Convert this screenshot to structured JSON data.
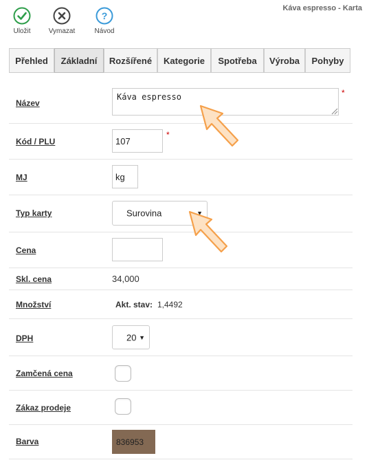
{
  "window": {
    "title": "Káva espresso - Karta"
  },
  "toolbar": {
    "save_label": "Uložit",
    "delete_label": "Vymazat",
    "help_label": "Návod",
    "save_color": "#2e9e4a",
    "delete_color": "#444444",
    "help_color": "#3a9ad9"
  },
  "tabs": [
    {
      "label": "Přehled"
    },
    {
      "label": "Základní",
      "active": true
    },
    {
      "label": "Rozšířené"
    },
    {
      "label": "Kategorie"
    },
    {
      "label": "Spotřeba"
    },
    {
      "label": "Výroba"
    },
    {
      "label": "Pohyby"
    }
  ],
  "form": {
    "nazev": {
      "label": "Název",
      "value": "Káva espresso",
      "required": "*"
    },
    "kod": {
      "label": "Kód / PLU",
      "value": "107",
      "required": "*"
    },
    "mj": {
      "label": "MJ",
      "value": "kg"
    },
    "typ": {
      "label": "Typ karty",
      "value": "Surovina"
    },
    "cena": {
      "label": "Cena",
      "value": ""
    },
    "skl_cena": {
      "label": "Skl. cena",
      "value": "34,000"
    },
    "mnozstvi": {
      "label": "Množství",
      "prefix": "Akt. stav:",
      "value": "1,4492"
    },
    "dph": {
      "label": "DPH",
      "value": "20"
    },
    "zamcena": {
      "label": "Zamčená cena",
      "checked": false
    },
    "zakaz": {
      "label": "Zákaz prodeje",
      "checked": false
    },
    "barva": {
      "label": "Barva",
      "value": "836953",
      "color": "#836953"
    }
  },
  "annotation": {
    "arrow_color": "#f5a04a",
    "arrow_fill": "#fde2c4"
  }
}
